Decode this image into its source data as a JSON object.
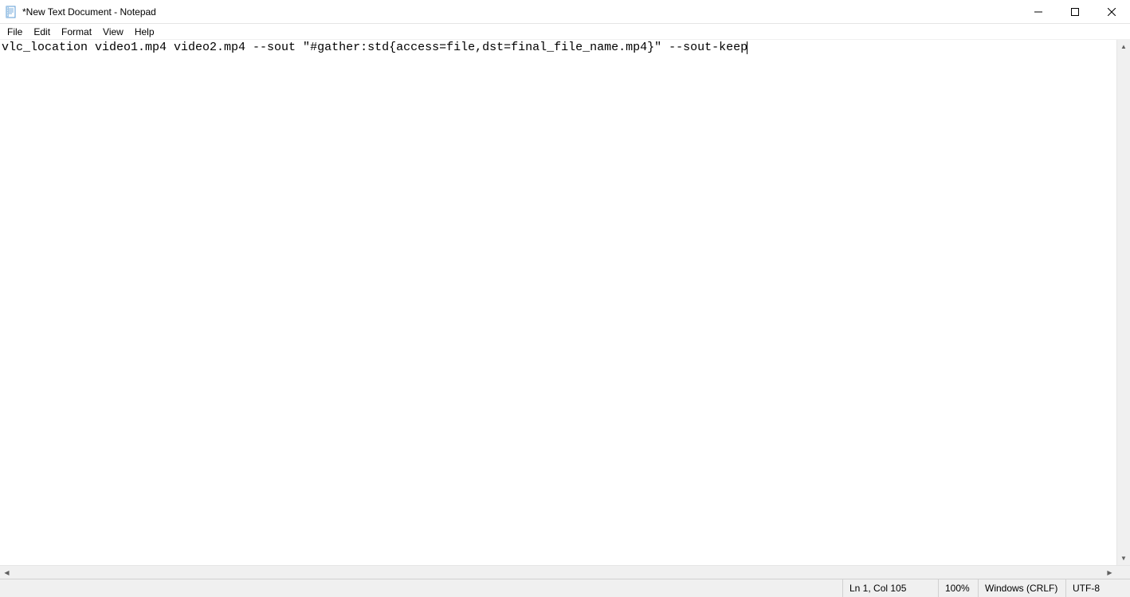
{
  "window": {
    "title": "*New Text Document - Notepad"
  },
  "menu": {
    "items": [
      "File",
      "Edit",
      "Format",
      "View",
      "Help"
    ]
  },
  "editor": {
    "content": "vlc_location video1.mp4 video2.mp4 --sout \"#gather:std{access=file,dst=final_file_name.mp4}\" --sout-keep"
  },
  "status": {
    "position": "Ln 1, Col 105",
    "zoom": "100%",
    "line_ending": "Windows (CRLF)",
    "encoding": "UTF-8"
  }
}
